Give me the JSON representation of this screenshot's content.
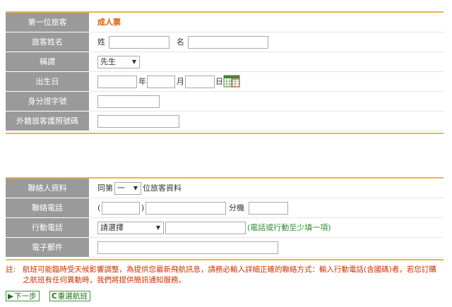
{
  "passenger": {
    "header_label": "第一位旅客",
    "ticket_type": "成人票",
    "name_label": "旅客姓名",
    "surname_label": "姓",
    "given_label": "名",
    "title_label": "稱謂",
    "title_value": "先生",
    "birth_label": "出生日",
    "year_label": "年",
    "month_label": "月",
    "day_label": "日",
    "id_label": "身分證字號",
    "passport_label": "外籍旅客護照號碼"
  },
  "contact": {
    "header_label": "聯絡人資料",
    "same_as_prefix": "同第",
    "same_as_value": "一",
    "same_as_suffix": "位旅客資料",
    "phone_label": "聯絡電話",
    "paren_open": "(",
    "paren_close": ")",
    "ext_label": "分機",
    "mobile_label": "行動電話",
    "mobile_select": "請選擇",
    "mobile_hint": "(電話或行動至少填一項)",
    "email_label": "電子郵件"
  },
  "note": {
    "label": "註:",
    "text": "航班可能臨時受天候影響調整，為提供您最新飛航訊息，請務必輸入詳細正確的聯絡方式：輸入行動電話(含國碼)者，若您訂購之航班有任何異動時，我們將提供簡訊通知服務。"
  },
  "buttons": {
    "next_label": "下一步",
    "reselect_label": "重選航班",
    "next_icon": "▶",
    "reselect_icon": "C"
  },
  "colors": {
    "label_bg": "#9a9a9a",
    "gold": "#e8b64a",
    "ticket": "#e05a00",
    "hint": "#2e8b2e",
    "note": "#cc3300"
  },
  "icons": {
    "calendar": "calendar-icon",
    "dropdown": "triangle-down"
  }
}
